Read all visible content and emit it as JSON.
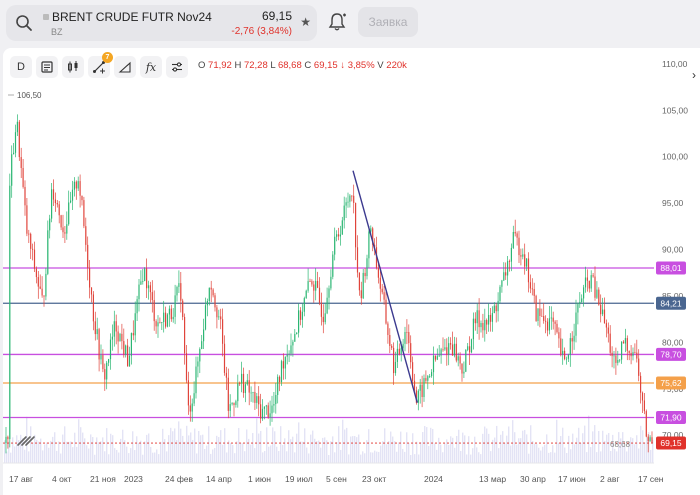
{
  "ticker": {
    "name": "BRENT CRUDE FUTR Nov24",
    "code": "BZ",
    "price": "69,15",
    "change": "-2,76 (3,84%)"
  },
  "order_button": "Заявка",
  "toolbar": {
    "interval": "D",
    "drawing_badge": "7",
    "tools": [
      "calendar-icon",
      "candles-icon",
      "drawing-tools-icon",
      "ruler-icon",
      "indicators-icon",
      "settings-sliders-icon"
    ],
    "fx_label": "fx"
  },
  "ohlc": {
    "o_label": "O",
    "o": "71,92",
    "h_label": "H",
    "h": "72,28",
    "l_label": "L",
    "l": "68,68",
    "c_label": "C",
    "c": "69,15",
    "arrow": "↓",
    "pct": "3,85%",
    "v_label": "V",
    "v": "220k"
  },
  "chart_data": {
    "type": "candlestick",
    "y_ticks": [
      "110,00",
      "105,00",
      "100,00",
      "95,00",
      "90,00",
      "85,00",
      "80,00",
      "75,00",
      "70,00"
    ],
    "ylim": [
      67,
      111.5
    ],
    "x_ticks": [
      "17 авг",
      "4 окт",
      "21 ноя",
      "2023",
      "24 фев",
      "14 апр",
      "1 июн",
      "19 июл",
      "5 сен",
      "23 окт",
      "2024",
      "13 мар",
      "30 апр",
      "17 июн",
      "2 авг",
      "17 сен"
    ],
    "max_label": "106,50",
    "min_label": "68,68",
    "horizontal_lines": [
      {
        "value": 88.01,
        "label": "88,01",
        "color": "#c84fe0"
      },
      {
        "value": 84.21,
        "label": "84,21",
        "color": "#4a6690"
      },
      {
        "value": 78.7,
        "label": "78,70",
        "color": "#c84fe0"
      },
      {
        "value": 75.62,
        "label": "75,62",
        "color": "#f4a04a"
      },
      {
        "value": 71.9,
        "label": "71,90",
        "color": "#c84fe0"
      }
    ],
    "last_price": {
      "value": 69.15,
      "label": "69,15",
      "color": "#e0322b"
    },
    "trend_line": {
      "from": {
        "x": "2023-09-28",
        "y": 98.5
      },
      "to": {
        "x": "2023-12-13",
        "y": 73.5
      },
      "color": "#3c3a8f"
    },
    "path": [
      [
        "2022-08-17",
        96.5
      ],
      [
        "2022-08-26",
        104
      ],
      [
        "2022-09-07",
        92
      ],
      [
        "2022-09-26",
        84
      ],
      [
        "2022-10-07",
        97
      ],
      [
        "2022-10-21",
        92
      ],
      [
        "2022-11-07",
        98
      ],
      [
        "2022-11-25",
        83
      ],
      [
        "2022-12-07",
        76
      ],
      [
        "2022-12-21",
        82
      ],
      [
        "2023-01-05",
        78
      ],
      [
        "2023-01-23",
        88
      ],
      [
        "2023-02-08",
        82
      ],
      [
        "2023-02-24",
        83
      ],
      [
        "2023-03-08",
        86
      ],
      [
        "2023-03-17",
        72.5
      ],
      [
        "2023-03-24",
        75
      ],
      [
        "2023-04-12",
        87
      ],
      [
        "2023-04-24",
        82
      ],
      [
        "2023-05-04",
        72.5
      ],
      [
        "2023-05-19",
        76
      ],
      [
        "2023-06-12",
        72.5
      ],
      [
        "2023-06-26",
        73
      ],
      [
        "2023-07-07",
        78
      ],
      [
        "2023-07-21",
        81
      ],
      [
        "2023-08-10",
        87
      ],
      [
        "2023-08-24",
        83
      ],
      [
        "2023-09-05",
        90
      ],
      [
        "2023-09-27",
        97
      ],
      [
        "2023-10-06",
        84
      ],
      [
        "2023-10-19",
        92.5
      ],
      [
        "2023-11-01",
        85
      ],
      [
        "2023-11-16",
        77
      ],
      [
        "2023-11-30",
        82
      ],
      [
        "2023-12-12",
        73.5
      ],
      [
        "2024-01-03",
        78
      ],
      [
        "2024-01-22",
        80
      ],
      [
        "2024-02-05",
        77
      ],
      [
        "2024-02-20",
        82.5
      ],
      [
        "2024-03-08",
        82
      ],
      [
        "2024-03-22",
        86
      ],
      [
        "2024-04-05",
        91
      ],
      [
        "2024-04-16",
        90
      ],
      [
        "2024-05-02",
        83
      ],
      [
        "2024-05-21",
        82
      ],
      [
        "2024-06-04",
        77.5
      ],
      [
        "2024-06-24",
        85
      ],
      [
        "2024-07-05",
        87
      ],
      [
        "2024-07-22",
        82
      ],
      [
        "2024-08-05",
        76.5
      ],
      [
        "2024-08-12",
        80
      ],
      [
        "2024-08-27",
        79
      ],
      [
        "2024-09-10",
        69.5
      ],
      [
        "2024-09-17",
        69.15
      ]
    ]
  }
}
